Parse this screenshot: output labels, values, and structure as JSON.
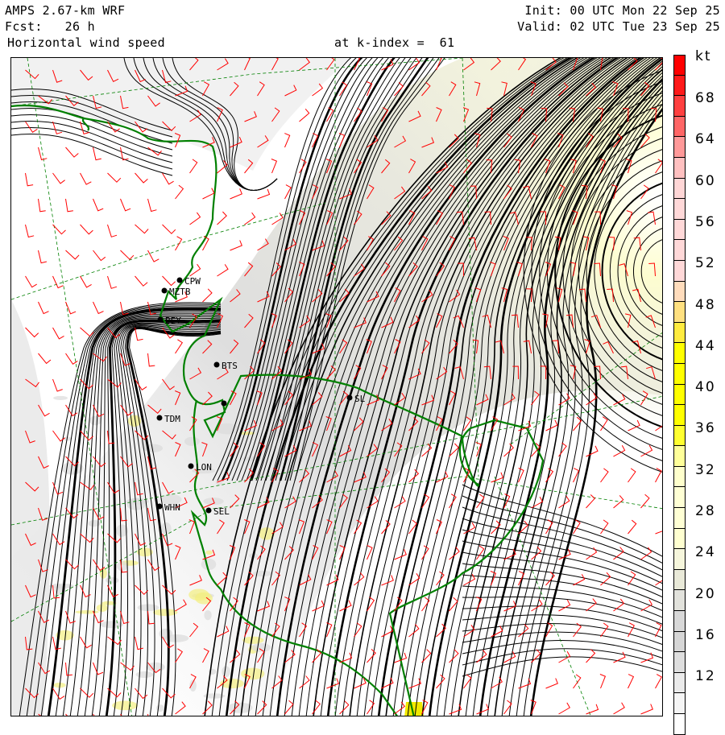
{
  "header": {
    "model": "AMPS 2.67-km WRF",
    "forecast": "Fcst:   26 h",
    "field": "Horizontal wind speed",
    "level": "at k-index =  61",
    "init": "Init: 00 UTC Mon 22 Sep 25",
    "valid": "Valid: 02 UTC Tue 23 Sep 25"
  },
  "colorbar": {
    "unit": "kt",
    "labels": [
      "68",
      "64",
      "60",
      "56",
      "52",
      "48",
      "44",
      "40",
      "36",
      "32",
      "28",
      "24",
      "20",
      "16",
      "12"
    ],
    "colors_top_to_bottom": [
      "#ff0000",
      "#ff1a1a",
      "#ff4040",
      "#ff6666",
      "#ff9999",
      "#ffc0c0",
      "#ffd6d6",
      "#ffd8d8",
      "#ffd8d8",
      "#ffd8d8",
      "#ffd8d8",
      "#ffdcbc",
      "#ffe080",
      "#ffeb40",
      "#ffff00",
      "#ffff00",
      "#ffff00",
      "#ffff00",
      "#ffff30",
      "#ffff99",
      "#ffffcc",
      "#ffffd4",
      "#ffffd4",
      "#ffffd0",
      "#f6f6dc",
      "#e9e9d8",
      "#e2e2dc",
      "#d8d8d8",
      "#d6d6d6",
      "#dedede",
      "#eaeaea",
      "#f5f5f5",
      "#ffffff"
    ]
  },
  "stations": [
    {
      "id": "CPW",
      "label": "CPW"
    },
    {
      "id": "MZTB",
      "label": "MZTB"
    },
    {
      "id": "BEY",
      "label": "BEY"
    },
    {
      "id": "BTS",
      "label": "BTS"
    },
    {
      "id": "TDM",
      "label": "TDM"
    },
    {
      "id": "LON",
      "label": "LON"
    },
    {
      "id": "WHN",
      "label": "WHN"
    },
    {
      "id": "SEL",
      "label": "SEL"
    },
    {
      "id": "SL",
      "label": "SL"
    }
  ],
  "colors": {
    "barb": "#ff0000",
    "coast": "#008000",
    "streamline": "#000000"
  }
}
